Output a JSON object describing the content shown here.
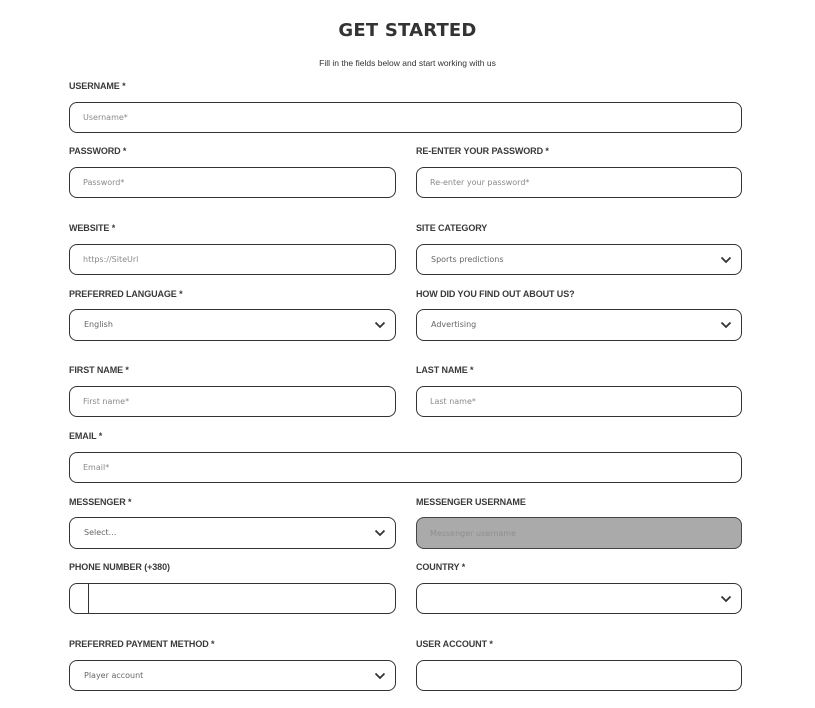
{
  "header": {
    "title": "GET STARTED",
    "subtitle": "Fill in the fields below and start working with us"
  },
  "fields": {
    "username": {
      "label": "USERNAME *",
      "placeholder": "Username*",
      "value": ""
    },
    "password": {
      "label": "PASSWORD *",
      "placeholder": "Password*",
      "value": ""
    },
    "reenter_password": {
      "label": "RE-ENTER YOUR PASSWORD *",
      "placeholder": "Re-enter your password*",
      "value": ""
    },
    "website": {
      "label": "WEBSITE *",
      "placeholder": "https://SiteUrl",
      "value": ""
    },
    "site_category": {
      "label": "SITE CATEGORY",
      "selected": "Sports predictions",
      "icon": "chevron-down-icon"
    },
    "preferred_language": {
      "label": "PREFERRED LANGUAGE *",
      "selected": "English",
      "icon": "chevron-down-icon"
    },
    "how_found": {
      "label": "HOW DID YOU FIND OUT ABOUT US?",
      "selected": "Advertising",
      "icon": "chevron-down-icon"
    },
    "first_name": {
      "label": "FIRST NAME *",
      "placeholder": "First name*",
      "value": ""
    },
    "last_name": {
      "label": "LAST NAME *",
      "placeholder": "Last name*",
      "value": ""
    },
    "email": {
      "label": "EMAIL *",
      "placeholder": "Email*",
      "value": ""
    },
    "messenger": {
      "label": "MESSENGER *",
      "selected": "Select...",
      "icon": "chevron-down-icon"
    },
    "messenger_username": {
      "label": "MESSENGER USERNAME",
      "placeholder": "Messenger username",
      "value": "",
      "disabled": true
    },
    "phone": {
      "label": "PHONE NUMBER (+380)",
      "value": ""
    },
    "country": {
      "label": "COUNTRY *",
      "selected": "",
      "icon": "chevron-down-icon"
    },
    "payment_method": {
      "label": "PREFERRED PAYMENT METHOD *",
      "selected": "Player account",
      "icon": "chevron-down-icon"
    },
    "user_account": {
      "label": "USER ACCOUNT *",
      "value": ""
    }
  },
  "colors": {
    "border": "#333333",
    "disabled_bg": "#aaaaaa",
    "text": "#333333"
  }
}
